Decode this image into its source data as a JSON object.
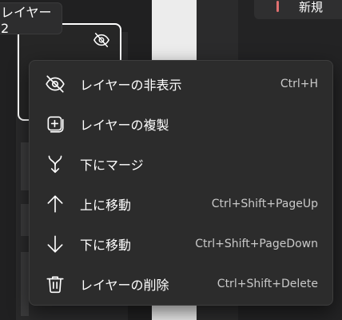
{
  "background": {
    "tooltip_text": "レイヤー 2",
    "new_button_label": "新規"
  },
  "menu": {
    "items": [
      {
        "label": "レイヤーの非表示",
        "shortcut": "Ctrl+H",
        "icon": "eye-off-icon"
      },
      {
        "label": "レイヤーの複製",
        "shortcut": "",
        "icon": "duplicate-icon"
      },
      {
        "label": "下にマージ",
        "shortcut": "",
        "icon": "merge-down-icon"
      },
      {
        "label": "上に移動",
        "shortcut": "Ctrl+Shift+PageUp",
        "icon": "arrow-up-icon"
      },
      {
        "label": "下に移動",
        "shortcut": "Ctrl+Shift+PageDown",
        "icon": "arrow-down-icon"
      },
      {
        "label": "レイヤーの削除",
        "shortcut": "Ctrl+Shift+Delete",
        "icon": "trash-icon"
      }
    ]
  },
  "colors": {
    "menu_bg": "#2c2c2c",
    "text": "#ffffff",
    "shortcut_text": "#c9c9c9",
    "accent": "#e07070"
  }
}
